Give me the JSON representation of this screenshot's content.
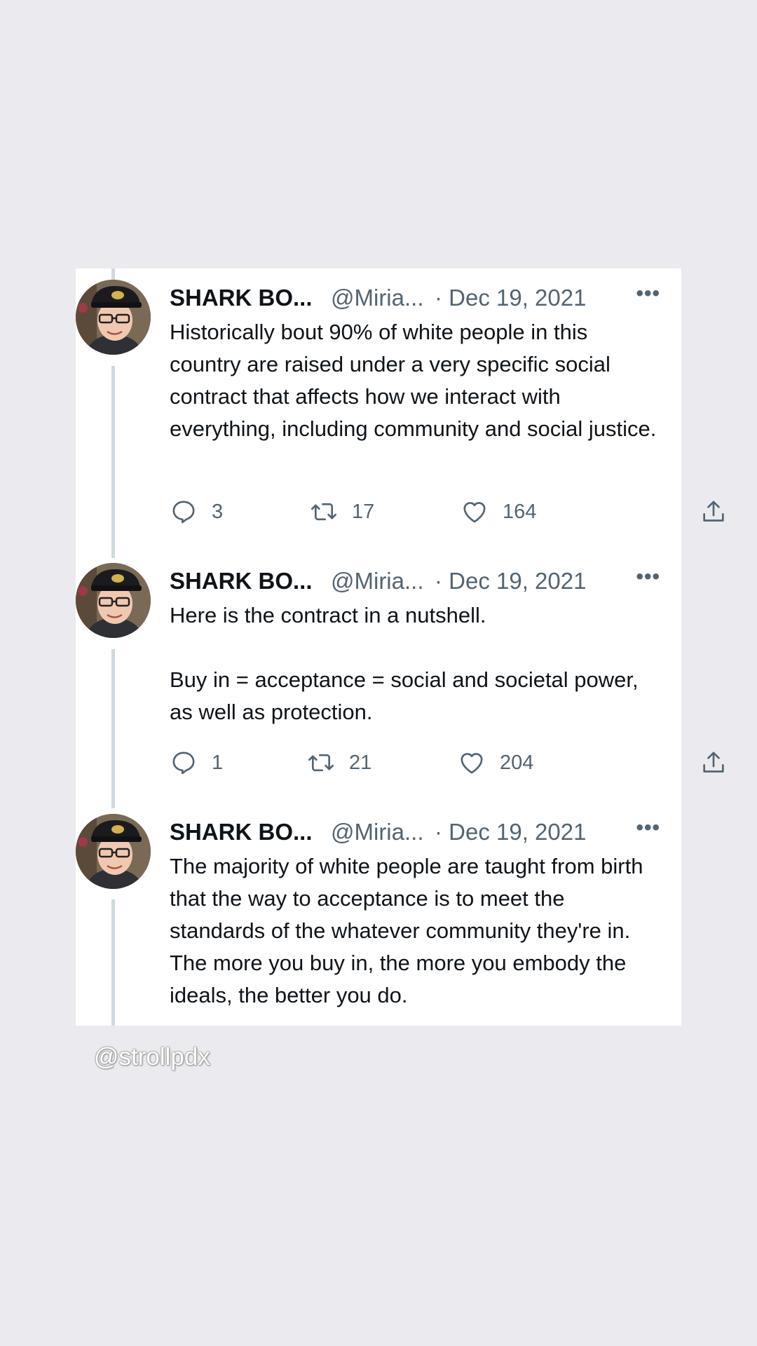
{
  "tweets": [
    {
      "name": "SHARK BO...",
      "handle": "@Miria...",
      "date": "· Dec 19, 2021",
      "more": "•••",
      "text": "Historically bout 90% of white people in this country are raised under a very specific social contract that affects how we interact with everything, including community and social justice.",
      "replies": "3",
      "retweets": "17",
      "likes": "164"
    },
    {
      "name": "SHARK BO...",
      "handle": "@Miria...",
      "date": "· Dec 19, 2021",
      "more": "•••",
      "text": "Here is the contract in a nutshell.\n\nBuy in = acceptance = social and societal power, as well as protection.",
      "replies": "1",
      "retweets": "21",
      "likes": "204"
    },
    {
      "name": "SHARK BO...",
      "handle": "@Miria...",
      "date": "· Dec 19, 2021",
      "more": "•••",
      "text": "The majority of white people are taught from birth that the way to acceptance is to meet the standards of the whatever community they're in. The more you buy in, the more you embody the ideals, the better you do."
    }
  ],
  "icons": {
    "reply": "reply-icon",
    "retweet": "retweet-icon",
    "like": "heart-icon",
    "share": "share-icon"
  },
  "colors": {
    "background": "#ebebef",
    "card": "#ffffff",
    "text": "#0f1419",
    "secondary": "#536471",
    "thread_line": "#cfd9de"
  },
  "watermark": "@strollpdx"
}
